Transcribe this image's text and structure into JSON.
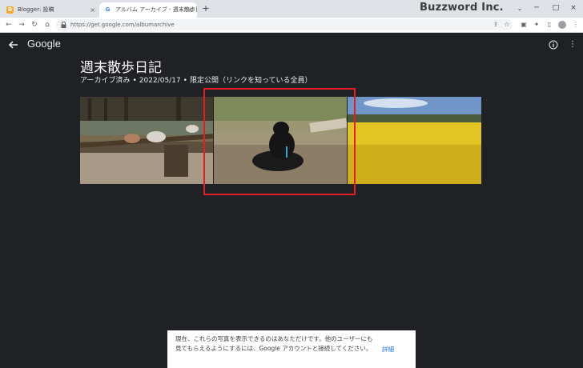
{
  "browser": {
    "tabs": [
      {
        "label": "Blogger: 投稿",
        "favicon": "B",
        "close": "×"
      },
      {
        "label": "アルバム アーカイブ - 週末散歩日記",
        "favicon": "G",
        "close": "×"
      }
    ],
    "new_tab": "+",
    "window_buttons": [
      "─",
      "□",
      "×"
    ],
    "url": "https://get.google.com/albumarchive",
    "brand_watermark": "Buzzword Inc."
  },
  "header": {
    "logo": "Google"
  },
  "album": {
    "title": "週末散歩日記",
    "status": "アーカイブ済み",
    "date": "2022/05/17",
    "visibility": "限定公開（リンクを知っている全員）",
    "separator": "•"
  },
  "photos": [
    {
      "name": "goats-on-bridge"
    },
    {
      "name": "black-lamb"
    },
    {
      "name": "rapeseed-field"
    }
  ],
  "notice": {
    "text": "現在、これらの写真を表示できるのはあなただけです。他のユーザーにも見てもらえるようにするには、Google アカウントと接続してください。",
    "link": "詳細"
  },
  "colors": {
    "background": "#202124",
    "highlight": "#e02020",
    "link": "#1a73e8"
  }
}
